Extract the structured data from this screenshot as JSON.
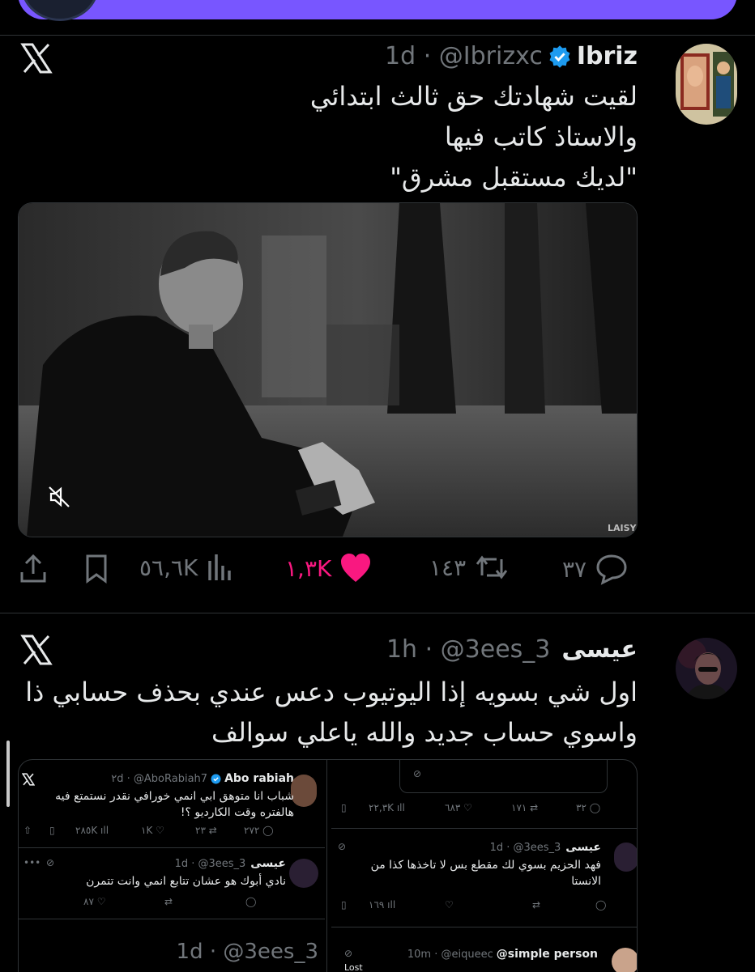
{
  "colors": {
    "accent_purple": "#7856ff",
    "like_pink": "#f91880",
    "verified_blue": "#1d9bf0",
    "muted": "#71767b",
    "text": "#e7e9ea"
  },
  "tweet1": {
    "name": "Ibriz",
    "handle_time": "1d · @Ibrizxc",
    "lines": [
      "لقيت شهادتك حق ثالث ابتدائي",
      "والاستاذ كاتب فيها",
      "\"لديك مستقبل مشرق\""
    ],
    "watermark": "LAISY",
    "stats": {
      "replies": "٣٧",
      "reposts": "١٤٣",
      "likes": "١,٣K",
      "views": "٥٦,٦K"
    }
  },
  "tweet2": {
    "name": "عيسى",
    "handle_time": "1h · @3ees_3",
    "lines": [
      "اول شي بسويه إذا اليوتيوب دعس عندي بحذف حسابي ذا",
      "واسوي حساب جديد والله ياعلي سوالف"
    ]
  },
  "screenshot": {
    "left": {
      "t1_name": "Abo rabiah",
      "t1_meta": "٢d · @AboRabiah7",
      "t1_lines": [
        "شباب انا متوهق ابي انمي خورافي نقدر نستمتع فيه",
        "هالفتره وقت الكارديو ؟!"
      ],
      "t1_stats": {
        "replies": "٢٧٢",
        "reposts": "٢٣",
        "likes": "١K",
        "views": "٢٨٥K"
      },
      "t2_name": "عيسى",
      "t2_meta": "1d · @3ees_3",
      "t2_line": "نادي أبوك هو عشان تتابع انمي وانت تتمرن",
      "t2_stats": {
        "likes": "٨٧"
      },
      "bottom_meta": "1d · @3ees_3"
    },
    "right": {
      "stats1": {
        "replies": "٣٢",
        "reposts": "١٧١",
        "likes": "٦٨٣",
        "views": "٢٢,٣K"
      },
      "t_name": "عيسى",
      "t_meta": "1d · @3ees_3",
      "t_lines": [
        "فهد الحزيم بسوي لك مقطع بس لا تاخذها كذا من",
        "الانستا"
      ],
      "t_stats": {
        "views": "١٦٩"
      },
      "bottom_name": "@simple person",
      "bottom_meta": "10m · @eiqueec",
      "bottom_lost": "Lost"
    }
  }
}
